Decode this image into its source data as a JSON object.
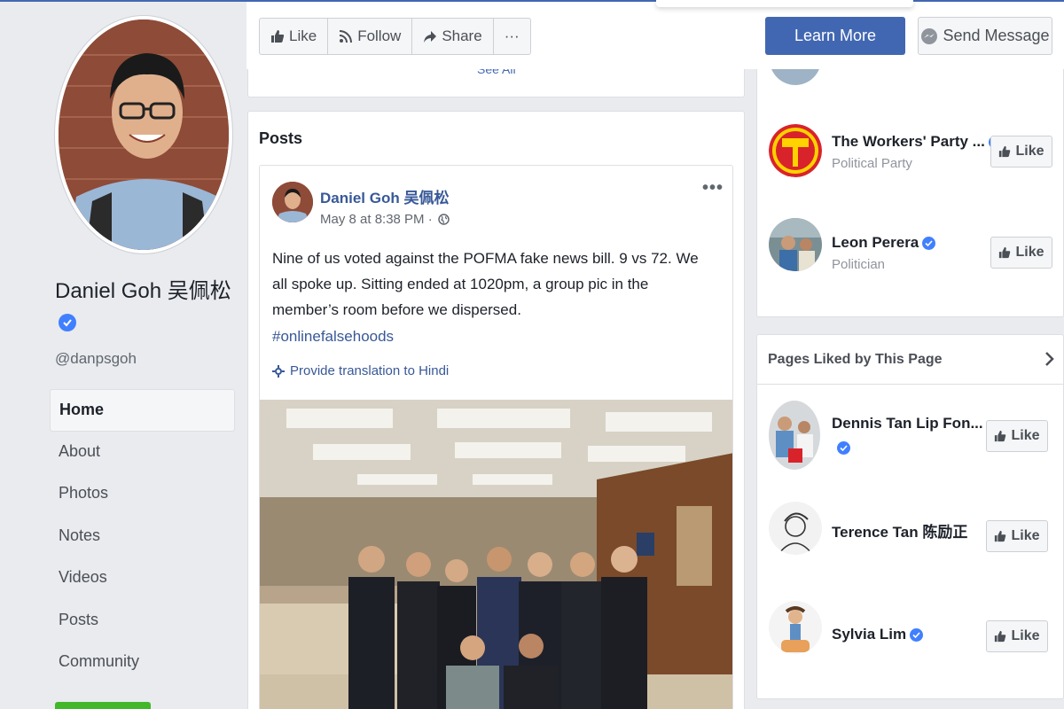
{
  "page": {
    "name": "Daniel Goh 吴佩松",
    "handle": "@danpsgoh"
  },
  "nav": {
    "items": [
      {
        "label": "Home",
        "active": true
      },
      {
        "label": "About"
      },
      {
        "label": "Photos"
      },
      {
        "label": "Notes"
      },
      {
        "label": "Videos"
      },
      {
        "label": "Posts"
      },
      {
        "label": "Community"
      }
    ]
  },
  "actions": {
    "like": "Like",
    "follow": "Follow",
    "share": "Share",
    "more": "···",
    "learn_more": "Learn More",
    "send_message": "Send Message"
  },
  "feed": {
    "see_all": "See All",
    "section_title": "Posts",
    "post": {
      "author": "Daniel Goh 吴佩松",
      "date": "May 8 at 8:38 PM ·",
      "text": "Nine of us voted against the POFMA fake news bill. 9 vs 72. We all spoke up. Sitting ended at 1020pm, a group pic in the member’s room before we dispersed.",
      "hashtag": "#onlinefalsehoods",
      "translate": "Provide translation to Hindi",
      "more": "•••"
    }
  },
  "right": {
    "related": [
      {
        "name": "The Workers' Party ...",
        "sub": "Political Party",
        "verified": true,
        "like": "Like"
      },
      {
        "name": "Leon Perera",
        "sub": "Politician",
        "verified": true,
        "like": "Like"
      }
    ],
    "liked_title": "Pages Liked by This Page",
    "liked": [
      {
        "name": "Dennis Tan Lip Fon...",
        "like": "Like"
      },
      {
        "name": "Terence Tan 陈励正",
        "like": "Like"
      },
      {
        "name": "Sylvia Lim",
        "like": "Like"
      }
    ]
  },
  "colors": {
    "brand": "#4267b2",
    "link": "#385898",
    "background": "#e9ebee",
    "verified": "#4080ff",
    "workers_party_red": "#d9232a",
    "workers_party_yellow": "#ffd200"
  }
}
